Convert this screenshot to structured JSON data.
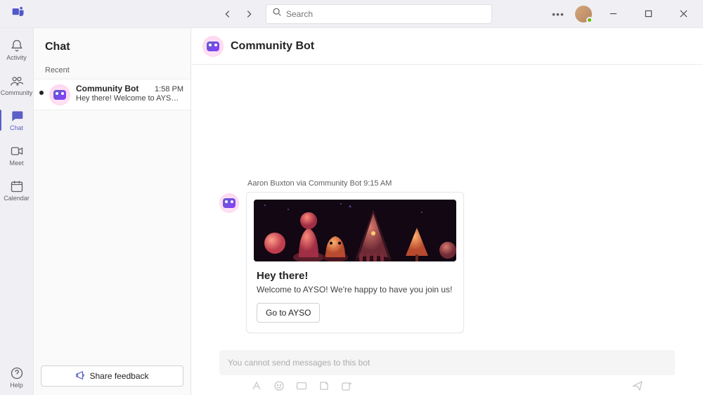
{
  "search": {
    "placeholder": "Search"
  },
  "rail": {
    "activity": "Activity",
    "community": "Community",
    "chat": "Chat",
    "meet": "Meet",
    "calendar": "Calendar",
    "help": "Help"
  },
  "chat_panel": {
    "title": "Chat",
    "section_recent": "Recent",
    "items": [
      {
        "name": "Community Bot",
        "preview": "Hey there! Welcome to AYSO…",
        "time": "1:58 PM"
      }
    ]
  },
  "feedback": {
    "label": "Share feedback"
  },
  "main": {
    "title": "Community Bot",
    "message": {
      "meta": "Aaron Buxton via Community Bot  9:15 AM",
      "card": {
        "title": "Hey there!",
        "desc": "Welcome to AYSO! We're happy to have you join us!",
        "button": "Go to AYSO"
      }
    },
    "compose_placeholder": "You cannot send messages to this bot"
  }
}
